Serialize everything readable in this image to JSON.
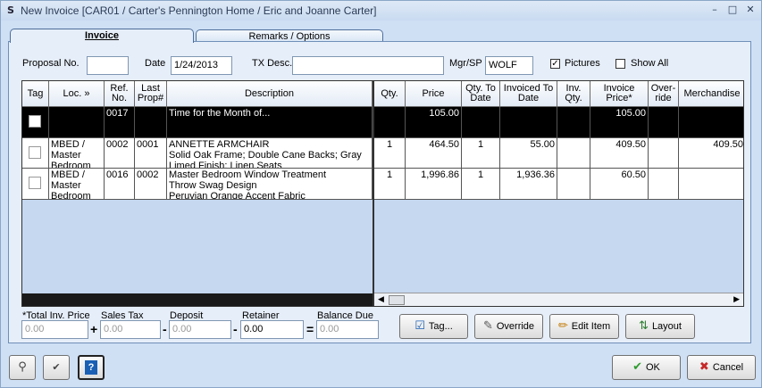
{
  "window": {
    "title": "New Invoice [CAR01 / Carter's Pennington Home / Eric and Joanne Carter]",
    "minimize_glyph": "–",
    "maximize_glyph": "□",
    "close_glyph": "✕"
  },
  "tabs": [
    {
      "label": "Invoice",
      "active": true
    },
    {
      "label": "Remarks / Options",
      "active": false
    }
  ],
  "form": {
    "proposal_label": "Proposal No.",
    "proposal_value": "",
    "date_label": "Date",
    "date_value": "1/24/2013",
    "tx_label": "TX Desc.",
    "tx_value": "",
    "mgr_label": "Mgr/SP",
    "mgr_value": "WOLF",
    "pictures_label": "Pictures",
    "pictures_checked": true,
    "showall_label": "Show All",
    "showall_checked": false
  },
  "grid": {
    "left_headers": [
      "Tag",
      "Loc. »",
      "Ref. No.",
      "Last Prop#",
      "Description"
    ],
    "right_headers": [
      "Qty.",
      "Price",
      "Qty. To Date",
      "Invoiced To Date",
      "Inv. Qty.",
      "Invoice Price*",
      "Over-ride",
      "Merchandise"
    ],
    "rows": [
      {
        "loc": "",
        "ref": "0017",
        "last": "",
        "desc": "Time for the Month of...",
        "qty": "",
        "price": "105.00",
        "qty_to_date": "",
        "invoiced_to_date": "",
        "inv_qty": "",
        "invoice_price": "105.00",
        "override": "",
        "merch": ""
      },
      {
        "loc": "MBED / Master Bedroom",
        "ref": "0002",
        "last": "0001",
        "desc": "ANNETTE ARMCHAIR\nSolid Oak Frame; Double Cane Backs; Gray Limed Finish; Linen Seats",
        "qty": "1",
        "price": "464.50",
        "qty_to_date": "1",
        "invoiced_to_date": "55.00",
        "inv_qty": "",
        "invoice_price": "409.50",
        "override": "",
        "merch": "409.50"
      },
      {
        "loc": "MBED / Master Bedroom",
        "ref": "0016",
        "last": "0002",
        "desc": "Master Bedroom Window Treatment\nThrow Swag Design\nPeruvian Orange Accent Fabric",
        "qty": "1",
        "price": "1,996.86",
        "qty_to_date": "1",
        "invoiced_to_date": "1,936.36",
        "inv_qty": "",
        "invoice_price": "60.50",
        "override": "",
        "merch": ""
      }
    ]
  },
  "totals": {
    "total_label": "*Total Inv. Price",
    "total_value": "0.00",
    "tax_label": "Sales Tax",
    "tax_value": "0.00",
    "deposit_label": "Deposit",
    "deposit_value": "0.00",
    "retainer_label": "Retainer",
    "retainer_value": "0.00",
    "balance_label": "Balance Due",
    "balance_value": "0.00",
    "op_plus": "+",
    "op_minus1": "-",
    "op_minus2": "-",
    "op_equals": "="
  },
  "buttons": {
    "tag": "Tag...",
    "override": "Override",
    "edit_item": "Edit Item",
    "layout": "Layout",
    "ok": "OK",
    "cancel": "Cancel"
  },
  "colors": {
    "window_bg": "#cfe0f5",
    "selected_row": "#000000",
    "ok_icon": "#2e9a2e",
    "cancel_icon": "#c62828"
  }
}
